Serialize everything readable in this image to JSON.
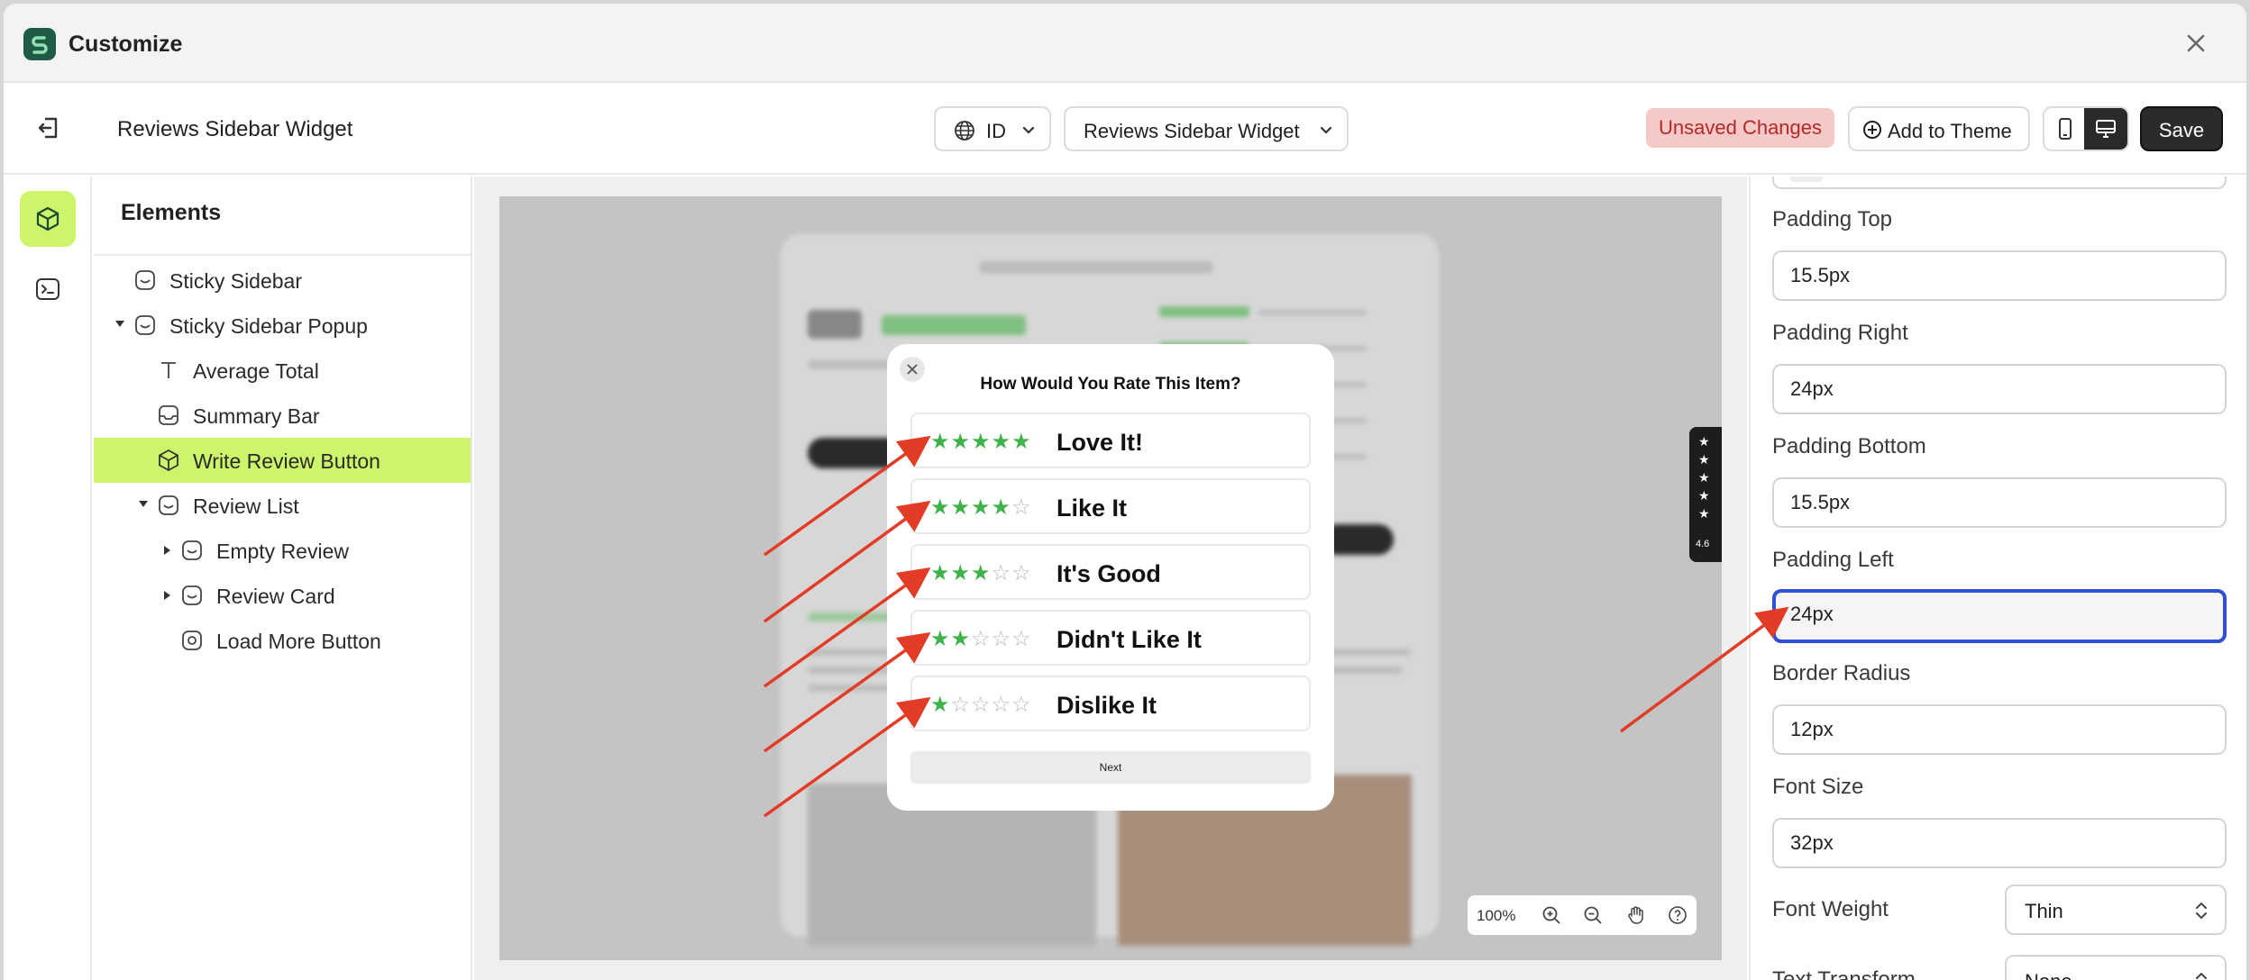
{
  "app": {
    "title": "Customize"
  },
  "header": {
    "title": "Reviews Sidebar Widget",
    "language": "ID",
    "widget_select": "Reviews Sidebar Widget",
    "unsaved": "Unsaved Changes",
    "add_to_theme": "Add to Theme",
    "save": "Save"
  },
  "elements": {
    "title": "Elements",
    "items": [
      {
        "label": "Sticky Sidebar"
      },
      {
        "label": "Sticky Sidebar Popup"
      },
      {
        "label": "Average Total"
      },
      {
        "label": "Summary Bar"
      },
      {
        "label": "Write Review Button"
      },
      {
        "label": "Review List"
      },
      {
        "label": "Empty Review"
      },
      {
        "label": "Review Card"
      },
      {
        "label": "Load More Button"
      }
    ]
  },
  "canvas": {
    "modal": {
      "title": "How Would You Rate This Item?",
      "options": [
        {
          "label": "Love It!",
          "rating": 5
        },
        {
          "label": "Like It",
          "rating": 4
        },
        {
          "label": "It's Good",
          "rating": 3
        },
        {
          "label": "Didn't Like It",
          "rating": 2
        },
        {
          "label": "Dislike It",
          "rating": 1
        }
      ],
      "next": "Next"
    },
    "side_tab_rating": "4.6",
    "zoom": "100%"
  },
  "props": {
    "padding_top": {
      "label": "Padding Top",
      "value": "15.5px"
    },
    "padding_right": {
      "label": "Padding Right",
      "value": "24px"
    },
    "padding_bottom": {
      "label": "Padding Bottom",
      "value": "15.5px"
    },
    "padding_left": {
      "label": "Padding Left",
      "value": "24px"
    },
    "border_radius": {
      "label": "Border Radius",
      "value": "12px"
    },
    "font_size": {
      "label": "Font Size",
      "value": "32px"
    },
    "font_weight": {
      "label": "Font Weight",
      "value": "Thin"
    },
    "text_transform": {
      "label": "Text Transform",
      "value": "None"
    }
  },
  "colors": {
    "accent": "#cdf56b",
    "annotation_arrow": "#e23c26",
    "star": "#3fb24a",
    "focus": "#2f4fd6"
  }
}
